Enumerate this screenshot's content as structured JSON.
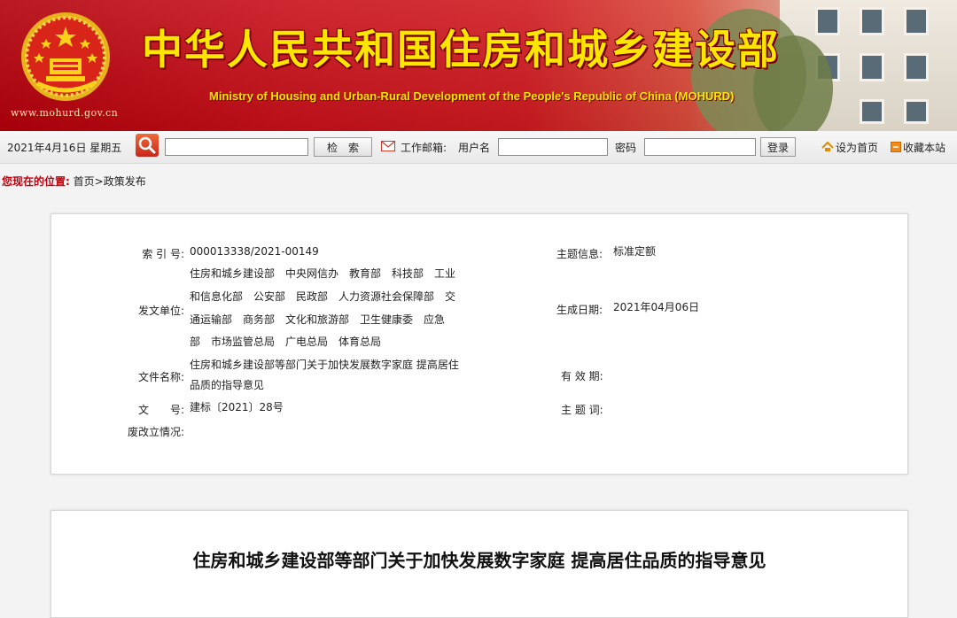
{
  "header": {
    "site_url": "www.mohurd.gov.cn",
    "title_cn": "中华人民共和国住房和城乡建设部",
    "title_en": "Ministry of Housing and Urban-Rural Development of the People's Republic of China (MOHURD)",
    "emblem_icon": "national-emblem-icon",
    "colors": {
      "banner_red": "#c8101a",
      "title_yellow": "#ffe600"
    }
  },
  "toolbar": {
    "date": "2021年4月16日 星期五",
    "search_placeholder": "",
    "search_button": "检　索",
    "mail_icon": "mail-icon",
    "mail_label": "工作邮箱:",
    "username_label": "用户名",
    "username_value": "",
    "password_label": "密码",
    "password_value": "",
    "login_button": "登录",
    "set_home_label": "设为首页",
    "favorite_label": "收藏本站"
  },
  "breadcrumb": {
    "label": "您现在的位置:",
    "path": "首页>政策发布"
  },
  "info": {
    "index_label": "索 引 号:",
    "index_value": "000013338/2021-00149",
    "issuer_label": "发文单位:",
    "issuer_lines": [
      "住房和城乡建设部　中央网信办　教育部　科技部　工业",
      "和信息化部　公安部　民政部　人力资源社会保障部　交",
      "通运输部　商务部　文化和旅游部　卫生健康委　应急",
      "部　市场监管总局　广电总局　体育总局"
    ],
    "filename_label": "文件名称:",
    "filename_lines": [
      "住房和城乡建设部等部门关于加快发展数字家庭 提高居住",
      "品质的指导意见"
    ],
    "docno_label": "文　　号:",
    "docno_value": "建标〔2021〕28号",
    "status_label": "废改立情况:",
    "topic_label": "主题信息:",
    "topic_value": "标准定额",
    "date_label": "生成日期:",
    "date_value": "2021年04月06日",
    "validity_label": "有 效 期:",
    "keywords_label": "主 题 词:"
  },
  "article": {
    "title": "住房和城乡建设部等部门关于加快发展数字家庭 提高居住品质的指导意见"
  }
}
